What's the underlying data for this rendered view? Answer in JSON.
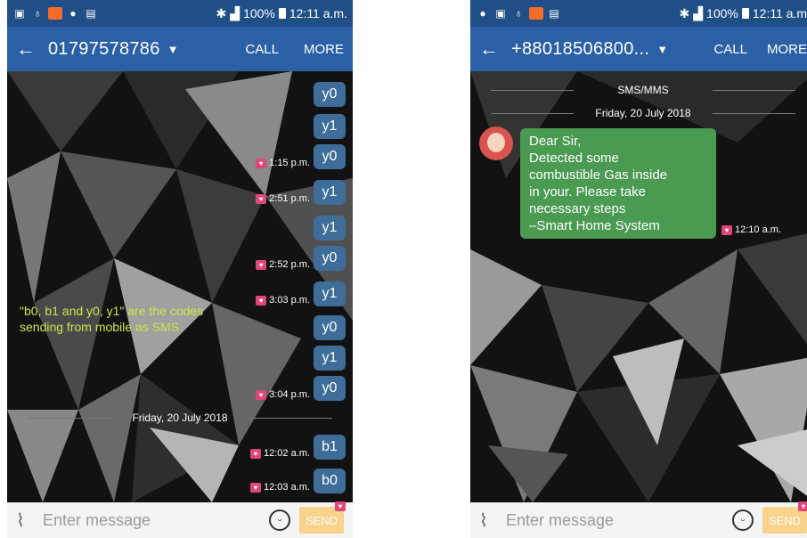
{
  "left": {
    "status": {
      "left_icons": [
        "camera-icon",
        "kb-icon",
        "app-icon",
        "chat-icon",
        "image-icon"
      ],
      "battery": "100%",
      "time": "12:11 a.m."
    },
    "appbar": {
      "contact": "01797578786",
      "call": "CALL",
      "more": "MORE"
    },
    "messages": [
      {
        "text": "y0",
        "time": ""
      },
      {
        "text": "y1",
        "time": ""
      },
      {
        "text": "y0",
        "time": "1:15 p.m."
      },
      {
        "text": "y1",
        "time": "2:51 p.m."
      },
      {
        "text": "y1",
        "time": ""
      },
      {
        "text": "y0",
        "time": "2:52 p.m."
      },
      {
        "text": "y1",
        "time": "3:03 p.m."
      },
      {
        "text": "y0",
        "time": ""
      },
      {
        "text": "y1",
        "time": ""
      },
      {
        "text": "y0",
        "time": "3:04 p.m."
      },
      {
        "text": "b1",
        "time": "12:02 a.m."
      },
      {
        "text": "b0",
        "time": "12:03 a.m."
      }
    ],
    "date_separator": "Friday, 20 July 2018",
    "annotation": "\"b0, b1 and y0, y1\" are the codes sending from mobile as SMS",
    "composer": {
      "placeholder": "Enter message",
      "send": "SEND"
    }
  },
  "right": {
    "status": {
      "battery": "100%",
      "time": "12:11 a.m."
    },
    "appbar": {
      "contact": "+88018506800...",
      "call": "CALL",
      "more": "MORE"
    },
    "channel": "SMS/MMS",
    "date_separator": "Friday, 20 July 2018",
    "incoming": {
      "lines": [
        "Dear Sir,",
        "Detected some",
        "combustible Gas inside",
        "in your. Please take",
        "necessary steps",
        "–Smart Home System"
      ],
      "time": "12:10 a.m."
    },
    "composer": {
      "placeholder": "Enter message",
      "send": "SEND"
    }
  },
  "colors": {
    "statusbar": "#1f4f86",
    "appbar": "#2b60a6",
    "outgoing": "#3d6d98",
    "incoming": "#4a9a52",
    "annotation": "#c8e84a",
    "send": "#f9d28c"
  }
}
